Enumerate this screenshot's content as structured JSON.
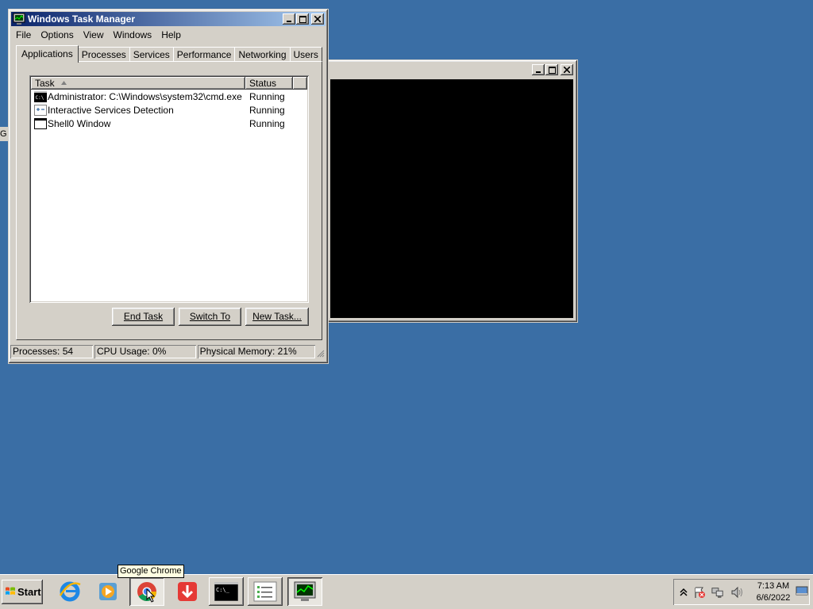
{
  "desktop": {
    "fragment_text": "G"
  },
  "console_window": {
    "title": ""
  },
  "task_manager": {
    "title": "Windows Task Manager",
    "menu": [
      "File",
      "Options",
      "View",
      "Windows",
      "Help"
    ],
    "tabs": [
      "Applications",
      "Processes",
      "Services",
      "Performance",
      "Networking",
      "Users"
    ],
    "active_tab": "Applications",
    "columns": {
      "task": "Task",
      "status": "Status"
    },
    "rows": [
      {
        "icon": "cmd-icon",
        "task": "Administrator: C:\\Windows\\system32\\cmd.exe",
        "status": "Running"
      },
      {
        "icon": "services-icon",
        "task": "Interactive Services Detection",
        "status": "Running"
      },
      {
        "icon": "window-icon",
        "task": "Shell0 Window",
        "status": "Running"
      }
    ],
    "buttons": {
      "end_task": "End Task",
      "switch_to": "Switch To",
      "new_task": "New Task..."
    },
    "status_bar": {
      "processes": "Processes: 54",
      "cpu": "CPU Usage: 0%",
      "memory": "Physical Memory: 21%"
    }
  },
  "taskbar": {
    "start_label": "Start",
    "tooltip": "Google Chrome",
    "items": [
      "ie-icon",
      "media-player-icon",
      "chrome-icon",
      "download-icon",
      "cmd-icon",
      "notepad-list-icon",
      "task-manager-icon"
    ],
    "clock": {
      "time": "7:13 AM",
      "date": "6/6/2022"
    }
  },
  "colors": {
    "desktop": "#3a6ea5",
    "title_active": "#0a246a",
    "face": "#d4d0c8"
  }
}
